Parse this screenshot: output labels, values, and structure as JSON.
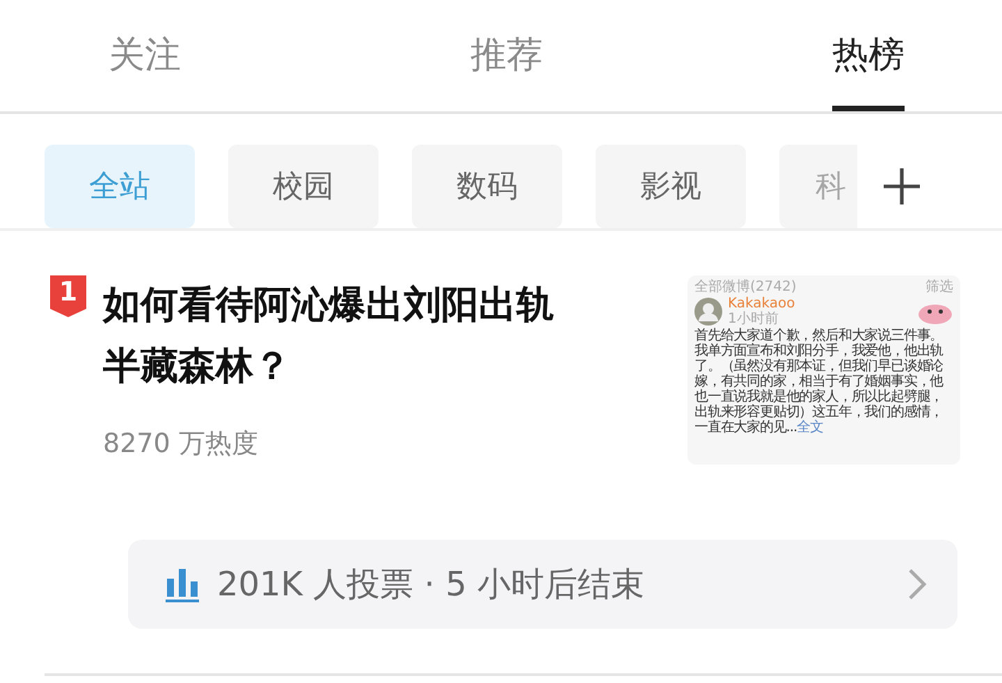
{
  "tabs": [
    {
      "label": "关注",
      "selected": false
    },
    {
      "label": "推荐",
      "selected": false
    },
    {
      "label": "热榜",
      "selected": true
    }
  ],
  "categories": [
    {
      "label": "全站",
      "selected": true
    },
    {
      "label": "校园",
      "selected": false
    },
    {
      "label": "数码",
      "selected": false
    },
    {
      "label": "影视",
      "selected": false
    },
    {
      "label": "科",
      "selected": false
    }
  ],
  "item": {
    "rank": "1",
    "title": "如何看待阿沁爆出刘阳出轨半藏森林？",
    "heat": "8270 万热度",
    "thumbnail": {
      "header": "全部微博(2742)",
      "filter": "筛选",
      "user": "Kakakaoo",
      "time": "1小时前",
      "body": "首先给大家道个歉，然后和大家说三件事。我单方面宣布和刘阳分手，我爱他，他出轨了。（虽然没有那本证，但我们早已谈婚论嫁，有共同的家，相当于有了婚姻事实，他也一直说我就是他的家人，所以比起劈腿，出轨来形容更贴切）这五年，我们的感情，一直在大家的见...",
      "more": "全文"
    },
    "poll": "201K 人投票 · 5 小时后结束"
  }
}
